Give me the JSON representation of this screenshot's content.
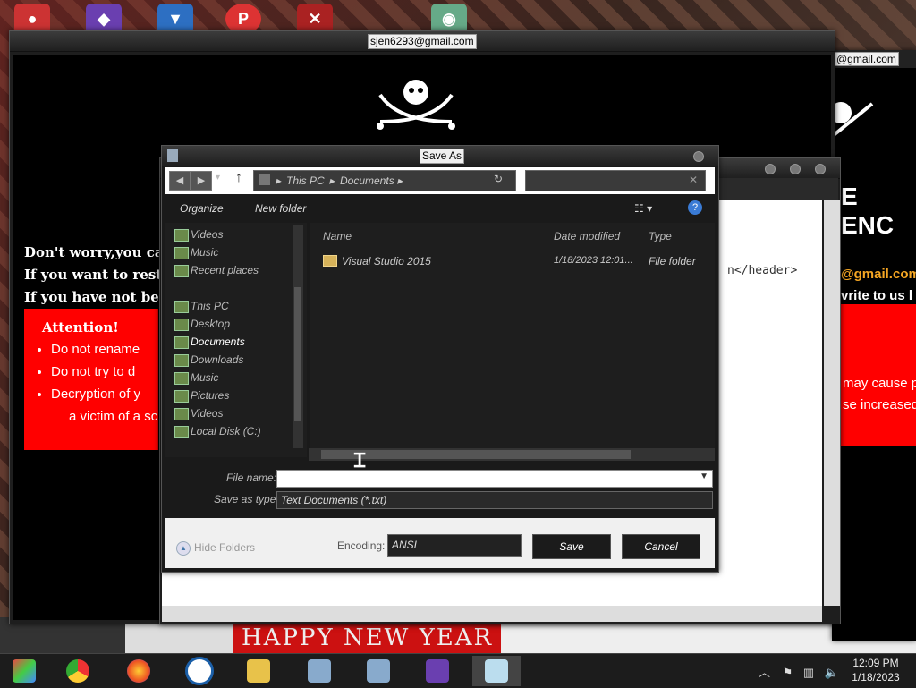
{
  "ransom_window": {
    "title": "sjen6293@gmail.com",
    "lines": [
      "Don't worry,you can",
      "If you want to resto",
      "If you have not been"
    ],
    "attention_title": "Attention!",
    "attention_items": [
      "Do not rename",
      "Do not try to d",
      "Decryption of y"
    ],
    "attention_continuation": "a victim of a sc"
  },
  "ransom_window_right": {
    "title": "@gmail.com",
    "heading": "E ENC",
    "email": "@gmail.com",
    "write_line": "vrite to us l",
    "red_lines": [
      "may cause p",
      "se increased"
    ]
  },
  "notepad": {
    "code_text": "n</header>"
  },
  "dialog": {
    "title": "Save As",
    "breadcrumb": [
      "This PC",
      "Documents"
    ],
    "toolbar": {
      "organize": "Organize",
      "new_folder": "New folder"
    },
    "nav_items": [
      {
        "label": "Videos"
      },
      {
        "label": "Music"
      },
      {
        "label": "Recent places"
      },
      {
        "label": "This PC"
      },
      {
        "label": "Desktop"
      },
      {
        "label": "Documents"
      },
      {
        "label": "Downloads"
      },
      {
        "label": "Music"
      },
      {
        "label": "Pictures"
      },
      {
        "label": "Videos"
      },
      {
        "label": "Local Disk (C:)"
      }
    ],
    "columns": {
      "name": "Name",
      "date": "Date modified",
      "type": "Type"
    },
    "files": [
      {
        "name": "Visual Studio 2015",
        "date": "1/18/2023 12:01...",
        "type": "File folder"
      }
    ],
    "file_name_label": "File name:",
    "file_name_value": "",
    "save_type_label": "Save as type:",
    "save_type_value": "Text Documents (*.txt)",
    "hide_folders": "Hide Folders",
    "encoding_label": "Encoding:",
    "encoding_value": "ANSI",
    "save": "Save",
    "cancel": "Cancel"
  },
  "desktop": {
    "banner": "HAPPY NEW YEAR"
  },
  "taskbar": {
    "apps": [
      "paint-icon",
      "chrome-icon",
      "firefox-icon",
      "office-icon",
      "file-explorer-icon",
      "installer-icon",
      "installer-icon-2",
      "visual-studio-icon",
      "notepad-icon"
    ],
    "time": "12:09 PM",
    "date": "1/18/2023"
  }
}
